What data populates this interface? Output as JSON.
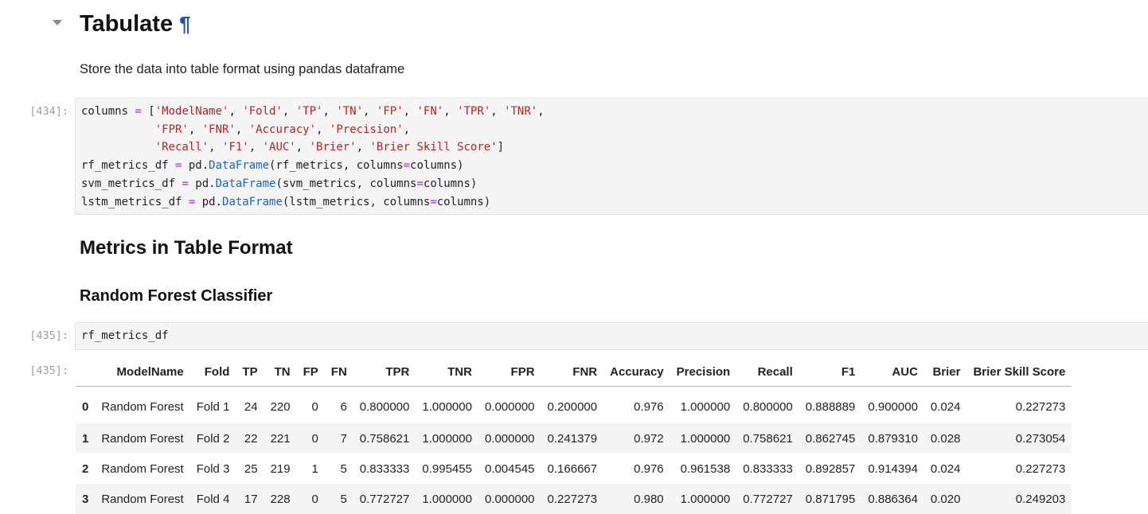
{
  "heading": {
    "title": "Tabulate",
    "anchor": "¶"
  },
  "intro_text": "Store the data into table format using pandas dataframe",
  "cell_434": {
    "prompt": "[434]:",
    "lines": [
      [
        [
          "t",
          "columns "
        ],
        [
          "o",
          "="
        ],
        [
          "t",
          " ["
        ],
        [
          "s",
          "'ModelName'"
        ],
        [
          "t",
          ", "
        ],
        [
          "s",
          "'Fold'"
        ],
        [
          "t",
          ", "
        ],
        [
          "s",
          "'TP'"
        ],
        [
          "t",
          ", "
        ],
        [
          "s",
          "'TN'"
        ],
        [
          "t",
          ", "
        ],
        [
          "s",
          "'FP'"
        ],
        [
          "t",
          ", "
        ],
        [
          "s",
          "'FN'"
        ],
        [
          "t",
          ", "
        ],
        [
          "s",
          "'TPR'"
        ],
        [
          "t",
          ", "
        ],
        [
          "s",
          "'TNR'"
        ],
        [
          "t",
          ","
        ]
      ],
      [
        [
          "t",
          "           "
        ],
        [
          "s",
          "'FPR'"
        ],
        [
          "t",
          ", "
        ],
        [
          "s",
          "'FNR'"
        ],
        [
          "t",
          ", "
        ],
        [
          "s",
          "'Accuracy'"
        ],
        [
          "t",
          ", "
        ],
        [
          "s",
          "'Precision'"
        ],
        [
          "t",
          ","
        ]
      ],
      [
        [
          "t",
          "           "
        ],
        [
          "s",
          "'Recall'"
        ],
        [
          "t",
          ", "
        ],
        [
          "s",
          "'F1'"
        ],
        [
          "t",
          ", "
        ],
        [
          "s",
          "'AUC'"
        ],
        [
          "t",
          ", "
        ],
        [
          "s",
          "'Brier'"
        ],
        [
          "t",
          ", "
        ],
        [
          "s",
          "'Brier Skill Score'"
        ],
        [
          "t",
          "]"
        ]
      ],
      [
        [
          "t",
          "rf_metrics_df "
        ],
        [
          "o",
          "="
        ],
        [
          "t",
          " pd."
        ],
        [
          "f",
          "DataFrame"
        ],
        [
          "t",
          "(rf_metrics, columns"
        ],
        [
          "o",
          "="
        ],
        [
          "t",
          "columns)"
        ]
      ],
      [
        [
          "t",
          "svm_metrics_df "
        ],
        [
          "o",
          "="
        ],
        [
          "t",
          " pd."
        ],
        [
          "f",
          "DataFrame"
        ],
        [
          "t",
          "(svm_metrics, columns"
        ],
        [
          "o",
          "="
        ],
        [
          "t",
          "columns)"
        ]
      ],
      [
        [
          "t",
          "lstm_metrics_df "
        ],
        [
          "o",
          "="
        ],
        [
          "t",
          " pd."
        ],
        [
          "f",
          "DataFrame"
        ],
        [
          "t",
          "(lstm_metrics, columns"
        ],
        [
          "o",
          "="
        ],
        [
          "t",
          "columns)"
        ]
      ]
    ]
  },
  "section_title": "Metrics in Table Format",
  "subsection_title": "Random Forest Classifier",
  "cell_435": {
    "prompt": "[435]:",
    "code": "rf_metrics_df",
    "output_prompt": "[435]:"
  },
  "table": {
    "columns": [
      "ModelName",
      "Fold",
      "TP",
      "TN",
      "FP",
      "FN",
      "TPR",
      "TNR",
      "FPR",
      "FNR",
      "Accuracy",
      "Precision",
      "Recall",
      "F1",
      "AUC",
      "Brier",
      "Brier Skill Score"
    ],
    "rows": [
      {
        "index": "0",
        "cells": [
          "Random Forest",
          "Fold 1",
          "24",
          "220",
          "0",
          "6",
          "0.800000",
          "1.000000",
          "0.000000",
          "0.200000",
          "0.976",
          "1.000000",
          "0.800000",
          "0.888889",
          "0.900000",
          "0.024",
          "0.227273"
        ]
      },
      {
        "index": "1",
        "cells": [
          "Random Forest",
          "Fold 2",
          "22",
          "221",
          "0",
          "7",
          "0.758621",
          "1.000000",
          "0.000000",
          "0.241379",
          "0.972",
          "1.000000",
          "0.758621",
          "0.862745",
          "0.879310",
          "0.028",
          "0.273054"
        ]
      },
      {
        "index": "2",
        "cells": [
          "Random Forest",
          "Fold 3",
          "25",
          "219",
          "1",
          "5",
          "0.833333",
          "0.995455",
          "0.004545",
          "0.166667",
          "0.976",
          "0.961538",
          "0.833333",
          "0.892857",
          "0.914394",
          "0.024",
          "0.227273"
        ]
      },
      {
        "index": "3",
        "cells": [
          "Random Forest",
          "Fold 4",
          "17",
          "228",
          "0",
          "5",
          "0.772727",
          "1.000000",
          "0.000000",
          "0.227273",
          "0.980",
          "1.000000",
          "0.772727",
          "0.871795",
          "0.886364",
          "0.020",
          "0.249203"
        ]
      }
    ]
  }
}
